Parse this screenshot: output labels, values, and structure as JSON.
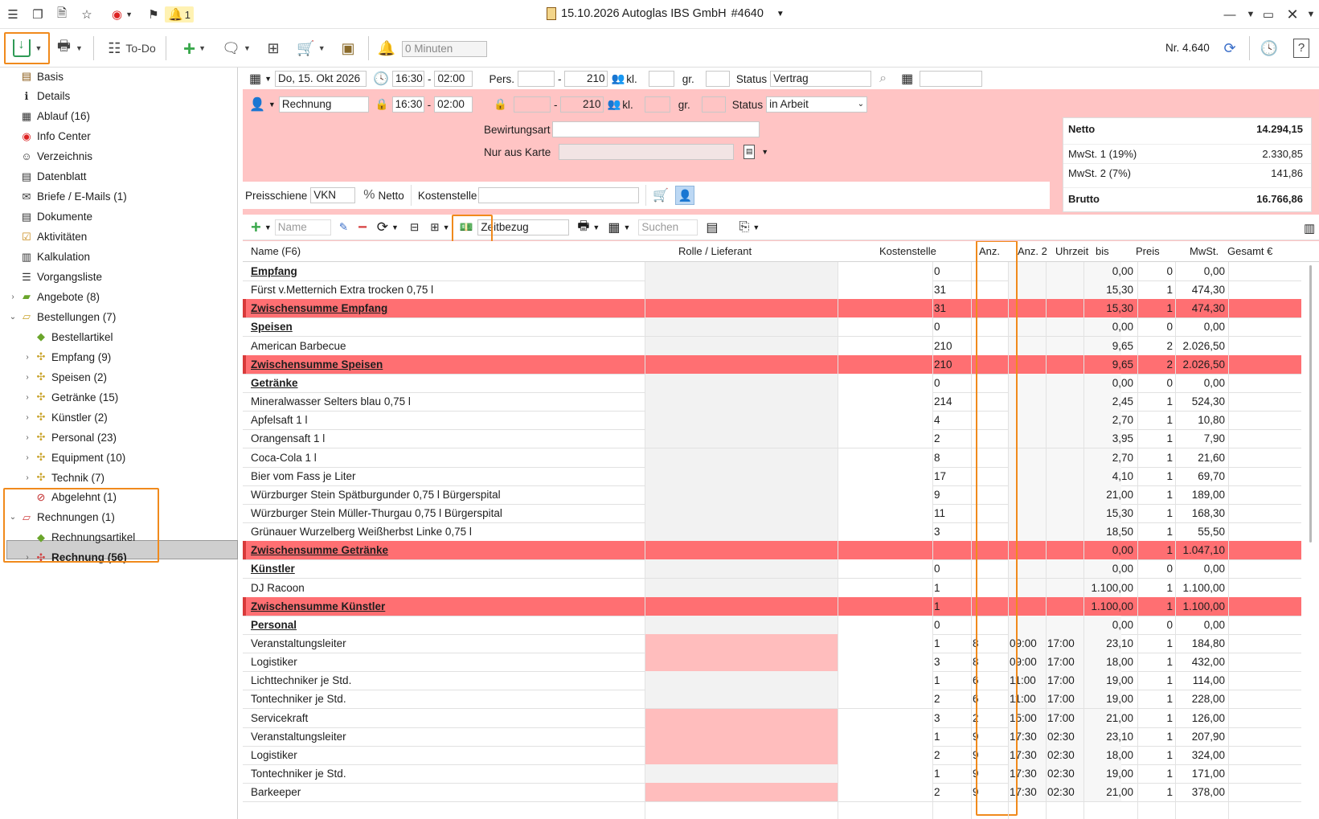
{
  "titlebar": {
    "notification_count": "1",
    "title": "15.10.2026 Autoglas IBS GmbH",
    "number": "#4640"
  },
  "toolbar": {
    "todo_label": "To-Do",
    "reminder_placeholder": "0 Minuten",
    "record_number": "Nr. 4.640"
  },
  "sidebar": {
    "items": [
      {
        "label": "Basis",
        "icon": "doc-icon"
      },
      {
        "label": "Details",
        "icon": "info-icon"
      },
      {
        "label": "Ablauf (16)",
        "icon": "table-icon"
      },
      {
        "label": "Info Center",
        "icon": "compass-icon"
      },
      {
        "label": "Verzeichnis",
        "icon": "people-icon"
      },
      {
        "label": "Datenblatt",
        "icon": "sheet-icon"
      },
      {
        "label": "Briefe / E-Mails (1)",
        "icon": "mail-icon"
      },
      {
        "label": "Dokumente",
        "icon": "documents-icon"
      },
      {
        "label": "Aktivitäten",
        "icon": "check-icon"
      },
      {
        "label": "Kalkulation",
        "icon": "calc-icon"
      },
      {
        "label": "Vorgangsliste",
        "icon": "list-icon"
      },
      {
        "label": "Angebote (8)",
        "icon": "folder-icon"
      },
      {
        "label": "Bestellungen (7)",
        "icon": "folder-open-icon"
      },
      {
        "label": "Bestellartikel",
        "icon": "tag-icon"
      },
      {
        "label": "Empfang (9)",
        "icon": "puzzle-icon"
      },
      {
        "label": "Speisen (2)",
        "icon": "puzzle-icon"
      },
      {
        "label": "Getränke (15)",
        "icon": "puzzle-icon"
      },
      {
        "label": "Künstler (2)",
        "icon": "puzzle-icon"
      },
      {
        "label": "Personal (23)",
        "icon": "puzzle-icon"
      },
      {
        "label": "Equipment (10)",
        "icon": "puzzle-icon"
      },
      {
        "label": "Technik (7)",
        "icon": "puzzle-icon"
      },
      {
        "label": "Abgelehnt (1)",
        "icon": "blocked-icon"
      },
      {
        "label": "Rechnungen (1)",
        "icon": "folder-open-red-icon"
      },
      {
        "label": "Rechnungsartikel",
        "icon": "tag-icon"
      },
      {
        "label": "Rechnung (56)",
        "icon": "puzzle-red-icon"
      }
    ]
  },
  "form": {
    "date": "Do, 15. Okt 2026",
    "time_from": "16:30",
    "time_to": "02:00",
    "pers_label": "Pers.",
    "pers_from": "",
    "pers_to": "210",
    "kl_label": "kl.",
    "gr_label": "gr.",
    "status_label": "Status",
    "status_value": "Vertrag",
    "doc_type": "Rechnung",
    "doc_time_from": "16:30",
    "doc_time_to": "02:00",
    "doc_pers_to": "210",
    "doc_status_value": "in Arbeit",
    "bewirtungsart_label": "Bewirtungsart",
    "nur_aus_karte_label": "Nur aus Karte",
    "preisschiene_label": "Preisschiene",
    "preisschiene_value": "VKN",
    "netto_label": "Netto",
    "kostenstelle_label": "Kostenstelle"
  },
  "totals": {
    "netto_label": "Netto",
    "netto_value": "14.294,15",
    "mwst1_label": "MwSt. 1 (19%)",
    "mwst1_value": "2.330,85",
    "mwst2_label": "MwSt. 2 (7%)",
    "mwst2_value": "141,86",
    "brutto_label": "Brutto",
    "brutto_value": "16.766,86"
  },
  "gridtoolbar": {
    "name_placeholder": "Name",
    "zeitbezug_value": "Zeitbezug",
    "search_placeholder": "Suchen"
  },
  "grid": {
    "columns": [
      "Name (F6)",
      "Rolle / Lieferant",
      "Kostenstelle",
      "Anz.",
      "Anz. 2",
      "Uhrzeit",
      "bis",
      "Preis",
      "MwSt.",
      "Gesamt €"
    ],
    "rows": [
      {
        "type": "group",
        "name": "Empfang",
        "anz": "0",
        "anz2": "",
        "uhrzeit": "",
        "bis": "",
        "preis": "0,00",
        "mwst": "0",
        "gesamt": "0,00"
      },
      {
        "type": "item",
        "name": "Fürst v.Metternich Extra trocken 0,75 l",
        "anz": "31",
        "anz2": "",
        "uhrzeit": "",
        "bis": "",
        "preis": "15,30",
        "mwst": "1",
        "gesamt": "474,30"
      },
      {
        "type": "sub",
        "name": "Zwischensumme Empfang",
        "anz": "31",
        "anz2": "",
        "uhrzeit": "",
        "bis": "",
        "preis": "15,30",
        "mwst": "1",
        "gesamt": "474,30"
      },
      {
        "type": "group",
        "name": "Speisen",
        "anz": "0",
        "anz2": "",
        "uhrzeit": "",
        "bis": "",
        "preis": "0,00",
        "mwst": "0",
        "gesamt": "0,00"
      },
      {
        "type": "item",
        "name": "American Barbecue",
        "anz": "210",
        "anz2": "",
        "uhrzeit": "",
        "bis": "",
        "preis": "9,65",
        "mwst": "2",
        "gesamt": "2.026,50"
      },
      {
        "type": "sub",
        "name": "Zwischensumme Speisen",
        "anz": "210",
        "anz2": "",
        "uhrzeit": "",
        "bis": "",
        "preis": "9,65",
        "mwst": "2",
        "gesamt": "2.026,50"
      },
      {
        "type": "group",
        "name": "Getränke",
        "anz": "0",
        "anz2": "",
        "uhrzeit": "",
        "bis": "",
        "preis": "0,00",
        "mwst": "0",
        "gesamt": "0,00"
      },
      {
        "type": "item",
        "name": "Mineralwasser Selters blau 0,75 l",
        "anz": "214",
        "anz2": "",
        "uhrzeit": "",
        "bis": "",
        "preis": "2,45",
        "mwst": "1",
        "gesamt": "524,30"
      },
      {
        "type": "item",
        "name": "Apfelsaft 1 l",
        "anz": "4",
        "anz2": "",
        "uhrzeit": "",
        "bis": "",
        "preis": "2,70",
        "mwst": "1",
        "gesamt": "10,80"
      },
      {
        "type": "item",
        "name": "Orangensaft 1 l",
        "anz": "2",
        "anz2": "",
        "uhrzeit": "",
        "bis": "",
        "preis": "3,95",
        "mwst": "1",
        "gesamt": "7,90"
      },
      {
        "type": "item",
        "name": "Coca-Cola 1 l",
        "anz": "8",
        "anz2": "",
        "uhrzeit": "",
        "bis": "",
        "preis": "2,70",
        "mwst": "1",
        "gesamt": "21,60"
      },
      {
        "type": "item",
        "name": "Bier vom Fass je Liter",
        "anz": "17",
        "anz2": "",
        "uhrzeit": "",
        "bis": "",
        "preis": "4,10",
        "mwst": "1",
        "gesamt": "69,70"
      },
      {
        "type": "item",
        "name": "Würzburger Stein Spätburgunder 0,75 l Bürgerspital",
        "anz": "9",
        "anz2": "",
        "uhrzeit": "",
        "bis": "",
        "preis": "21,00",
        "mwst": "1",
        "gesamt": "189,00"
      },
      {
        "type": "item",
        "name": "Würzburger Stein Müller-Thurgau 0,75 l Bürgerspital",
        "anz": "11",
        "anz2": "",
        "uhrzeit": "",
        "bis": "",
        "preis": "15,30",
        "mwst": "1",
        "gesamt": "168,30"
      },
      {
        "type": "item",
        "name": "Grünauer Wurzelberg Weißherbst Linke 0,75 l",
        "anz": "3",
        "anz2": "",
        "uhrzeit": "",
        "bis": "",
        "preis": "18,50",
        "mwst": "1",
        "gesamt": "55,50"
      },
      {
        "type": "sub",
        "name": "Zwischensumme Getränke",
        "anz": "",
        "anz2": "",
        "uhrzeit": "",
        "bis": "",
        "preis": "0,00",
        "mwst": "1",
        "gesamt": "1.047,10"
      },
      {
        "type": "group",
        "name": "Künstler",
        "anz": "0",
        "anz2": "",
        "uhrzeit": "",
        "bis": "",
        "preis": "0,00",
        "mwst": "0",
        "gesamt": "0,00"
      },
      {
        "type": "item",
        "name": "DJ Racoon",
        "anz": "1",
        "anz2": "",
        "uhrzeit": "",
        "bis": "",
        "preis": "1.100,00",
        "mwst": "1",
        "gesamt": "1.100,00"
      },
      {
        "type": "sub",
        "name": "Zwischensumme Künstler",
        "anz": "1",
        "anz2": "",
        "uhrzeit": "",
        "bis": "",
        "preis": "1.100,00",
        "mwst": "1",
        "gesamt": "1.100,00"
      },
      {
        "type": "group",
        "name": "Personal",
        "anz": "0",
        "anz2": "",
        "uhrzeit": "",
        "bis": "",
        "preis": "0,00",
        "mwst": "0",
        "gesamt": "0,00"
      },
      {
        "type": "item",
        "pink": true,
        "name": "Veranstaltungsleiter",
        "anz": "1",
        "anz2": "8",
        "uhrzeit": "09:00",
        "bis": "17:00",
        "preis": "23,10",
        "mwst": "1",
        "gesamt": "184,80"
      },
      {
        "type": "item",
        "pink": true,
        "name": "Logistiker",
        "anz": "3",
        "anz2": "8",
        "uhrzeit": "09:00",
        "bis": "17:00",
        "preis": "18,00",
        "mwst": "1",
        "gesamt": "432,00"
      },
      {
        "type": "item",
        "name": "Lichttechniker je Std.",
        "anz": "1",
        "anz2": "6",
        "uhrzeit": "11:00",
        "bis": "17:00",
        "preis": "19,00",
        "mwst": "1",
        "gesamt": "114,00"
      },
      {
        "type": "item",
        "name": "Tontechniker je Std.",
        "anz": "2",
        "anz2": "6",
        "uhrzeit": "11:00",
        "bis": "17:00",
        "preis": "19,00",
        "mwst": "1",
        "gesamt": "228,00"
      },
      {
        "type": "item",
        "pink": true,
        "name": "Servicekraft",
        "anz": "3",
        "anz2": "2",
        "uhrzeit": "15:00",
        "bis": "17:00",
        "preis": "21,00",
        "mwst": "1",
        "gesamt": "126,00"
      },
      {
        "type": "item",
        "pink": true,
        "name": "Veranstaltungsleiter",
        "anz": "1",
        "anz2": "9",
        "uhrzeit": "17:30",
        "bis": "02:30",
        "preis": "23,10",
        "mwst": "1",
        "gesamt": "207,90"
      },
      {
        "type": "item",
        "pink": true,
        "name": "Logistiker",
        "anz": "2",
        "anz2": "9",
        "uhrzeit": "17:30",
        "bis": "02:30",
        "preis": "18,00",
        "mwst": "1",
        "gesamt": "324,00"
      },
      {
        "type": "item",
        "name": "Tontechniker je Std.",
        "anz": "1",
        "anz2": "9",
        "uhrzeit": "17:30",
        "bis": "02:30",
        "preis": "19,00",
        "mwst": "1",
        "gesamt": "171,00"
      },
      {
        "type": "item",
        "pink": true,
        "name": "Barkeeper",
        "anz": "2",
        "anz2": "9",
        "uhrzeit": "17:30",
        "bis": "02:30",
        "preis": "21,00",
        "mwst": "1",
        "gesamt": "378,00"
      }
    ]
  },
  "colors": {
    "highlight": "#f08a1c",
    "form_bg": "#ffc4c4",
    "subtotal_bg": "#ff6f72",
    "marker": "#d83a3a",
    "pink_cell": "#ffbdbd",
    "selected_bg": "#cfcfcf"
  }
}
